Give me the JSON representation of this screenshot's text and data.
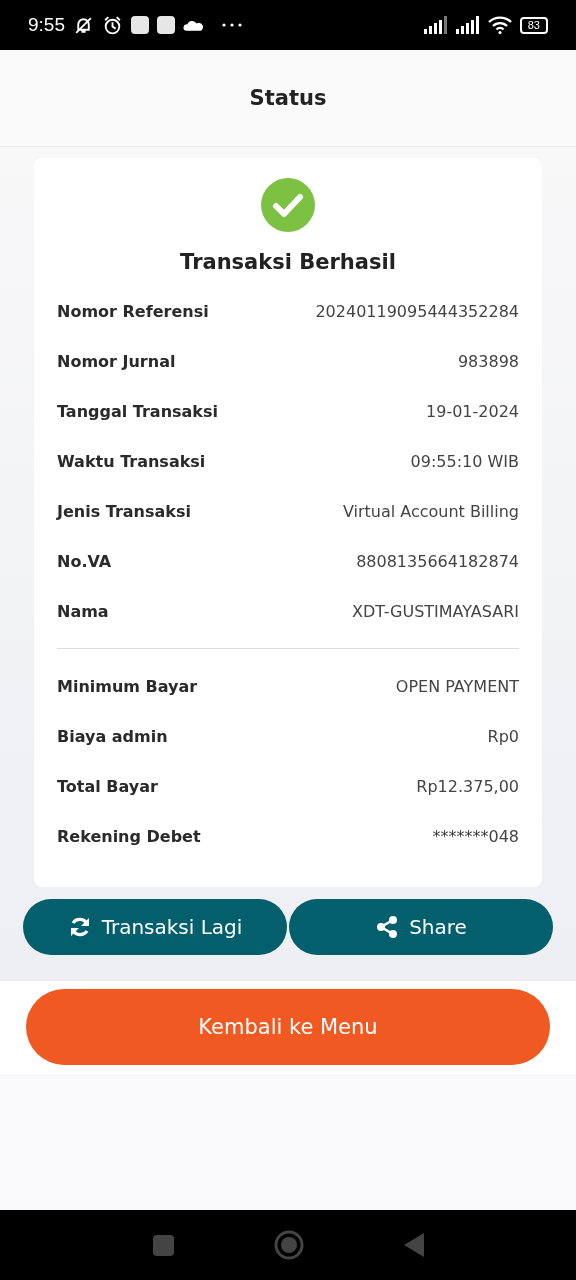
{
  "status_bar": {
    "time": "9:55",
    "battery": "83"
  },
  "header": {
    "title": "Status"
  },
  "result": {
    "title": "Transaksi Berhasil"
  },
  "detail_groups": [
    [
      {
        "label": "Nomor Referensi",
        "value": "20240119095444352284"
      },
      {
        "label": "Nomor Jurnal",
        "value": "983898"
      },
      {
        "label": "Tanggal Transaksi",
        "value": "19-01-2024"
      },
      {
        "label": "Waktu Transaksi",
        "value": "09:55:10 WIB"
      },
      {
        "label": "Jenis Transaksi",
        "value": "Virtual Account Billing"
      },
      {
        "label": "No.VA",
        "value": "8808135664182874"
      },
      {
        "label": "Nama",
        "value": "XDT-GUSTIMAYASARI"
      }
    ],
    [
      {
        "label": "Minimum Bayar",
        "value": "OPEN PAYMENT"
      },
      {
        "label": "Biaya admin",
        "value": "Rp0"
      },
      {
        "label": "Total Bayar",
        "value": "Rp12.375,00"
      },
      {
        "label": "Rekening Debet",
        "value": "*******048"
      }
    ]
  ],
  "actions": [
    {
      "kind": "repeat",
      "label": "Transaksi Lagi"
    },
    {
      "kind": "share",
      "label": "Share"
    }
  ],
  "primary_button": {
    "label": "Kembali ke Menu"
  }
}
